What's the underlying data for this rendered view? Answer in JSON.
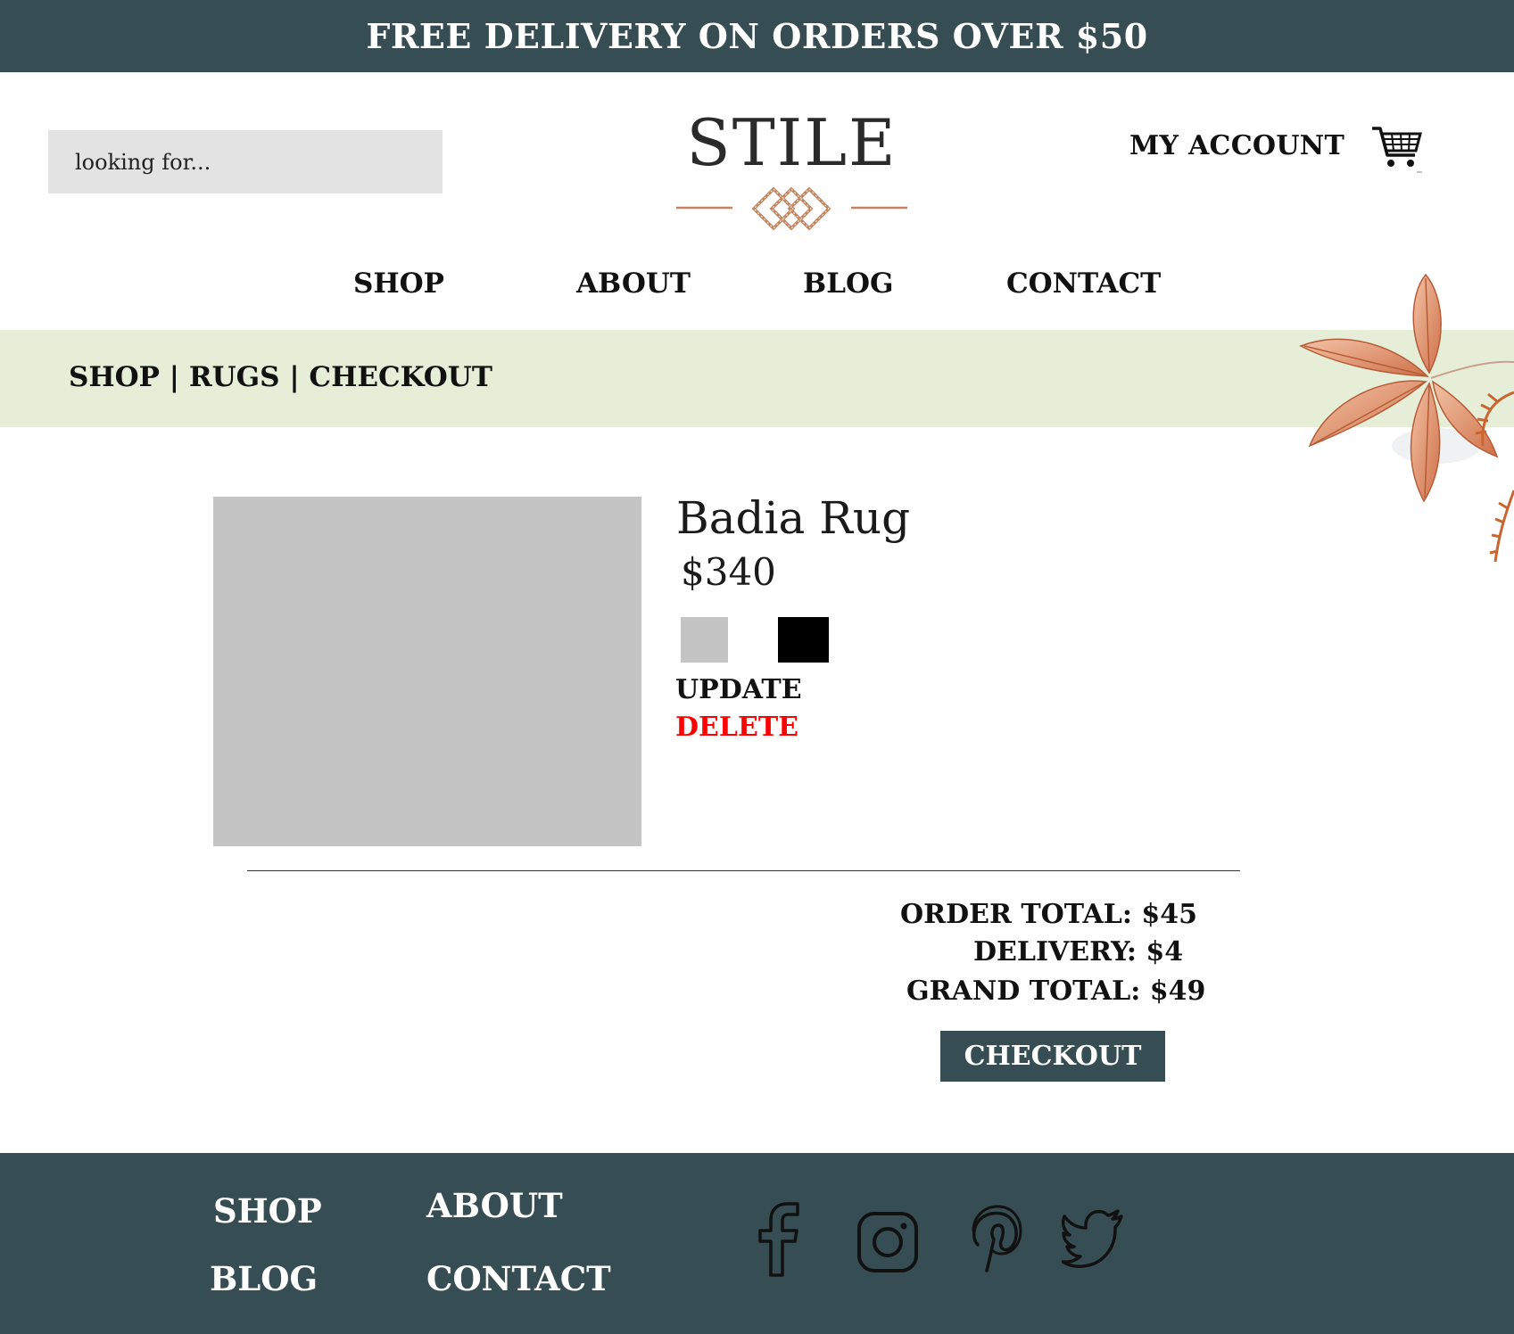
{
  "promo": {
    "text": "FREE DELIVERY ON ORDERS OVER $50"
  },
  "header": {
    "search_placeholder": "looking for...",
    "logo_text": "STILE",
    "account_label": "MY ACCOUNT",
    "cart_icon": "shopping-cart-icon"
  },
  "nav": {
    "items": [
      {
        "label": "SHOP"
      },
      {
        "label": "ABOUT"
      },
      {
        "label": "BLOG"
      },
      {
        "label": "CONTACT"
      }
    ]
  },
  "breadcrumb": {
    "items": [
      "SHOP",
      "RUGS",
      "CHECKOUT"
    ],
    "separator": "|"
  },
  "product": {
    "name": "Badia Rug",
    "price": "$340",
    "swatches": [
      {
        "color": "#c4c4c4"
      },
      {
        "color": "#000000"
      }
    ],
    "update_label": "UPDATE",
    "delete_label": "DELETE"
  },
  "totals": {
    "order_total": "ORDER TOTAL: $45",
    "delivery": "DELIVERY: $4",
    "grand_total": "GRAND TOTAL: $49",
    "checkout_label": "CHECKOUT"
  },
  "footer": {
    "links": [
      {
        "label": "SHOP"
      },
      {
        "label": "ABOUT"
      },
      {
        "label": "BLOG"
      },
      {
        "label": "CONTACT"
      }
    ],
    "social": [
      "facebook-icon",
      "instagram-icon",
      "pinterest-icon",
      "twitter-icon"
    ]
  },
  "colors": {
    "brand_dark": "#364e53",
    "accent_copper": "#c4845e",
    "breadcrumb_bg": "#e6eed7",
    "delete_red": "#ff0000"
  }
}
